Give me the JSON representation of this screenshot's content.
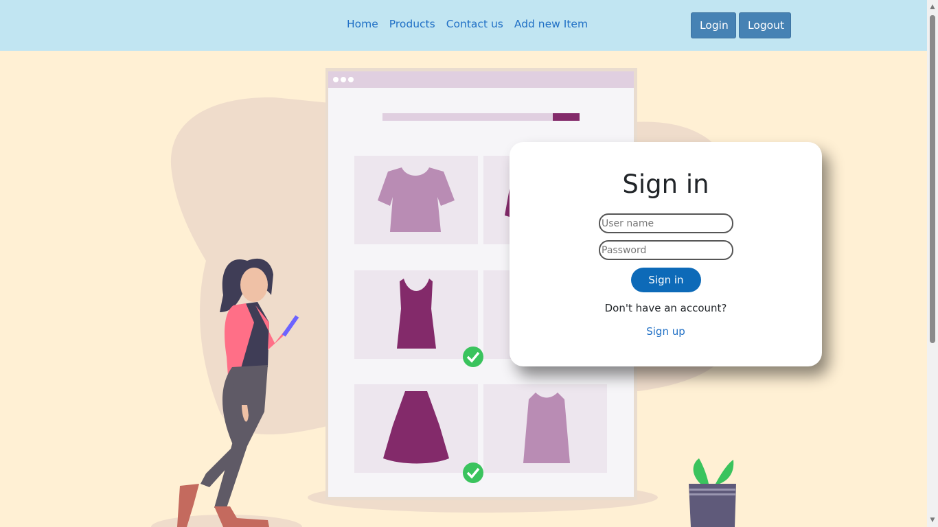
{
  "nav": {
    "links": [
      "Home",
      "Products",
      "Contact us",
      "Add new Item"
    ],
    "login_label": "Login",
    "logout_label": "Logout"
  },
  "signin": {
    "title": "Sign in",
    "username_placeholder": "User name",
    "password_placeholder": "Password",
    "button_label": "Sign in",
    "no_account_prompt": "Don't have an account?",
    "signup_label": "Sign up"
  },
  "colors": {
    "navbar_bg": "#c1e5f2",
    "page_bg": "#fff0d4",
    "nav_button": "#4682b4",
    "primary_button": "#0d6ab8",
    "link": "#1f6fc5",
    "accent_purple": "#832a6a",
    "check_green": "#3ac35d"
  },
  "icons": [
    "check-icon",
    "check-icon",
    "scroll-up-arrow-icon",
    "scroll-down-arrow-icon"
  ]
}
